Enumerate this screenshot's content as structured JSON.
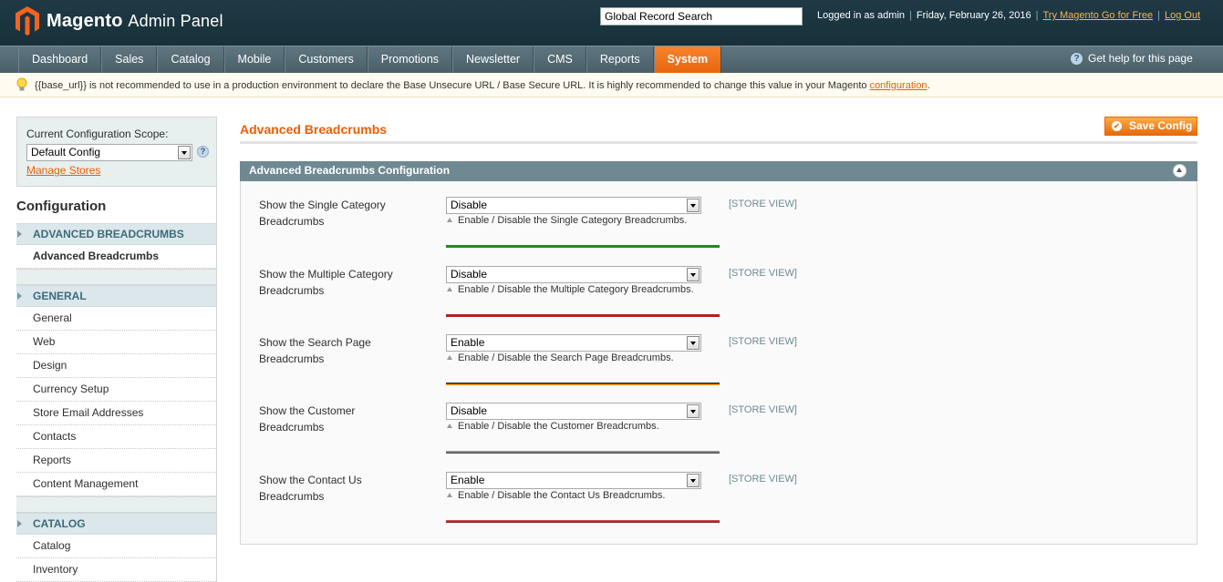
{
  "header": {
    "brand": "Magento",
    "brand_sub": "Admin Panel",
    "search_value": "Global Record Search",
    "logged_in": "Logged in as admin",
    "date": "Friday, February 26, 2016",
    "try_link": "Try Magento Go for Free",
    "logout": "Log Out"
  },
  "nav": {
    "items": [
      "Dashboard",
      "Sales",
      "Catalog",
      "Mobile",
      "Customers",
      "Promotions",
      "Newsletter",
      "CMS",
      "Reports",
      "System"
    ],
    "active": "System",
    "help": "Get help for this page"
  },
  "notice": {
    "text": "{{base_url}} is not recommended to use in a production environment to declare the Base Unsecure URL / Base Secure URL. It is highly recommended to change this value in your Magento ",
    "link": "configuration",
    "suffix": "."
  },
  "scope": {
    "label": "Current Configuration Scope:",
    "selected": "Default Config",
    "manage": "Manage Stores"
  },
  "sidebar": {
    "title": "Configuration",
    "sections": [
      {
        "head": "ADVANCED BREADCRUMBS",
        "items": [
          "Advanced Breadcrumbs"
        ]
      },
      {
        "head": "GENERAL",
        "items": [
          "General",
          "Web",
          "Design",
          "Currency Setup",
          "Store Email Addresses",
          "Contacts",
          "Reports",
          "Content Management"
        ]
      },
      {
        "head": "CATALOG",
        "items": [
          "Catalog",
          "Inventory"
        ]
      }
    ]
  },
  "main": {
    "title": "Advanced Breadcrumbs",
    "save": "Save Config",
    "fieldset": "Advanced Breadcrumbs Configuration",
    "rows": [
      {
        "label1": "Show the Single Category",
        "label2": "Breadcrumbs",
        "value": "Disable",
        "note": "Enable / Disable the Single Category Breadcrumbs.",
        "scope": "[STORE VIEW]",
        "colors": [
          "#1f8a1f"
        ]
      },
      {
        "label1": "Show the Multiple Category",
        "label2": "Breadcrumbs",
        "value": "Disable",
        "note": "Enable / Disable the Multiple Category Breadcrumbs.",
        "scope": "[STORE VIEW]",
        "colors": [
          "#b22020"
        ]
      },
      {
        "label1": "Show the Search Page",
        "label2": "Breadcrumbs",
        "value": "Enable",
        "note": "Enable / Disable the Search Page Breadcrumbs.",
        "scope": "[STORE VIEW]",
        "colors": [
          "#333333",
          "#d42020",
          "#f2b200"
        ]
      },
      {
        "label1": "Show the Customer",
        "label2": "Breadcrumbs",
        "value": "Disable",
        "note": "Enable / Disable the Customer Breadcrumbs.",
        "scope": "[STORE VIEW]",
        "colors": [
          "#9a9a9a",
          "#555555"
        ]
      },
      {
        "label1": "Show the Contact Us",
        "label2": "Breadcrumbs",
        "value": "Enable",
        "note": "Enable / Disable the Contact Us Breadcrumbs.",
        "scope": "[STORE VIEW]",
        "colors": [
          "#c84848",
          "#8a2020"
        ]
      }
    ]
  }
}
